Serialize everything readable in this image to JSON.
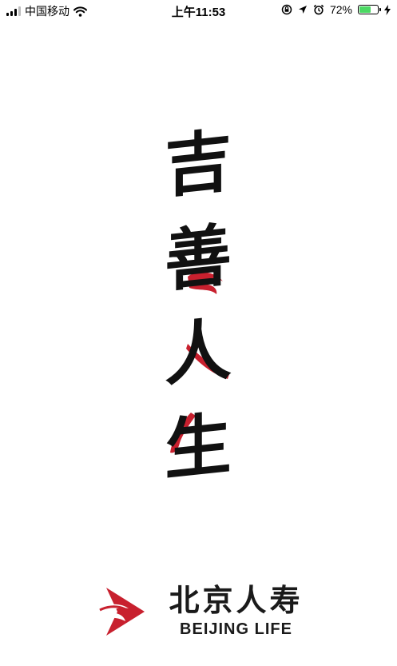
{
  "status_bar": {
    "carrier": "中国移动",
    "time": "上午11:53",
    "battery_percent": "72%",
    "battery_level": 0.72,
    "icons": [
      "signal-icon",
      "wifi-icon",
      "orientation-lock-icon",
      "location-icon",
      "alarm-icon",
      "battery-icon",
      "charging-icon"
    ]
  },
  "splash": {
    "calligraphy": [
      "吉",
      "善",
      "人",
      "生"
    ]
  },
  "logo": {
    "name_cn": "北京人寿",
    "name_en": "BEIJING LIFE"
  },
  "colors": {
    "brand_red": "#c8202e",
    "ink": "#111111",
    "battery_green": "#4cd964"
  }
}
